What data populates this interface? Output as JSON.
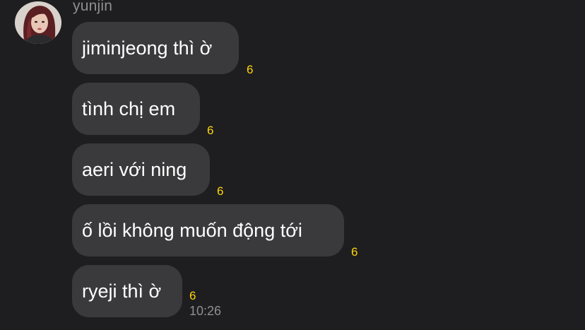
{
  "chat": {
    "sender": "yunjin",
    "messages": [
      {
        "text": "jiminjeong thì ờ",
        "reaction_count": "6"
      },
      {
        "text": "tình chị em",
        "reaction_count": "6"
      },
      {
        "text": "aeri với ning",
        "reaction_count": "6"
      },
      {
        "text": "ố lồi không muốn động tới",
        "reaction_count": "6"
      },
      {
        "text": "ryeji thì ờ",
        "reaction_count": "6"
      }
    ],
    "timestamp": "10:26"
  },
  "colors": {
    "background": "#1e1e20",
    "bubble": "#3a3a3c",
    "text": "#ffffff",
    "reaction": "#ffd60a",
    "meta": "#8e8e93"
  }
}
